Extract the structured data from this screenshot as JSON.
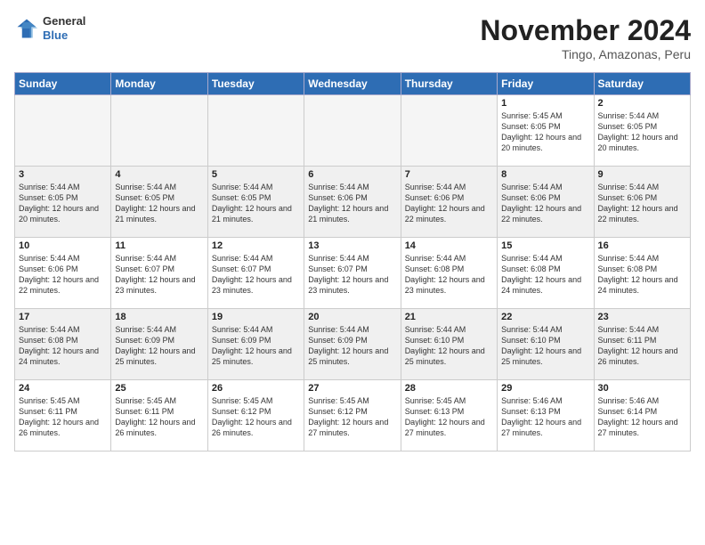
{
  "logo": {
    "general": "General",
    "blue": "Blue"
  },
  "header": {
    "month": "November 2024",
    "location": "Tingo, Amazonas, Peru"
  },
  "weekdays": [
    "Sunday",
    "Monday",
    "Tuesday",
    "Wednesday",
    "Thursday",
    "Friday",
    "Saturday"
  ],
  "weeks": [
    [
      {
        "day": "",
        "info": "",
        "empty": true
      },
      {
        "day": "",
        "info": "",
        "empty": true
      },
      {
        "day": "",
        "info": "",
        "empty": true
      },
      {
        "day": "",
        "info": "",
        "empty": true
      },
      {
        "day": "",
        "info": "",
        "empty": true
      },
      {
        "day": "1",
        "info": "Sunrise: 5:45 AM\nSunset: 6:05 PM\nDaylight: 12 hours and 20 minutes."
      },
      {
        "day": "2",
        "info": "Sunrise: 5:44 AM\nSunset: 6:05 PM\nDaylight: 12 hours and 20 minutes."
      }
    ],
    [
      {
        "day": "3",
        "info": "Sunrise: 5:44 AM\nSunset: 6:05 PM\nDaylight: 12 hours and 20 minutes."
      },
      {
        "day": "4",
        "info": "Sunrise: 5:44 AM\nSunset: 6:05 PM\nDaylight: 12 hours and 21 minutes."
      },
      {
        "day": "5",
        "info": "Sunrise: 5:44 AM\nSunset: 6:05 PM\nDaylight: 12 hours and 21 minutes."
      },
      {
        "day": "6",
        "info": "Sunrise: 5:44 AM\nSunset: 6:06 PM\nDaylight: 12 hours and 21 minutes."
      },
      {
        "day": "7",
        "info": "Sunrise: 5:44 AM\nSunset: 6:06 PM\nDaylight: 12 hours and 22 minutes."
      },
      {
        "day": "8",
        "info": "Sunrise: 5:44 AM\nSunset: 6:06 PM\nDaylight: 12 hours and 22 minutes."
      },
      {
        "day": "9",
        "info": "Sunrise: 5:44 AM\nSunset: 6:06 PM\nDaylight: 12 hours and 22 minutes."
      }
    ],
    [
      {
        "day": "10",
        "info": "Sunrise: 5:44 AM\nSunset: 6:06 PM\nDaylight: 12 hours and 22 minutes."
      },
      {
        "day": "11",
        "info": "Sunrise: 5:44 AM\nSunset: 6:07 PM\nDaylight: 12 hours and 23 minutes."
      },
      {
        "day": "12",
        "info": "Sunrise: 5:44 AM\nSunset: 6:07 PM\nDaylight: 12 hours and 23 minutes."
      },
      {
        "day": "13",
        "info": "Sunrise: 5:44 AM\nSunset: 6:07 PM\nDaylight: 12 hours and 23 minutes."
      },
      {
        "day": "14",
        "info": "Sunrise: 5:44 AM\nSunset: 6:08 PM\nDaylight: 12 hours and 23 minutes."
      },
      {
        "day": "15",
        "info": "Sunrise: 5:44 AM\nSunset: 6:08 PM\nDaylight: 12 hours and 24 minutes."
      },
      {
        "day": "16",
        "info": "Sunrise: 5:44 AM\nSunset: 6:08 PM\nDaylight: 12 hours and 24 minutes."
      }
    ],
    [
      {
        "day": "17",
        "info": "Sunrise: 5:44 AM\nSunset: 6:08 PM\nDaylight: 12 hours and 24 minutes."
      },
      {
        "day": "18",
        "info": "Sunrise: 5:44 AM\nSunset: 6:09 PM\nDaylight: 12 hours and 25 minutes."
      },
      {
        "day": "19",
        "info": "Sunrise: 5:44 AM\nSunset: 6:09 PM\nDaylight: 12 hours and 25 minutes."
      },
      {
        "day": "20",
        "info": "Sunrise: 5:44 AM\nSunset: 6:09 PM\nDaylight: 12 hours and 25 minutes."
      },
      {
        "day": "21",
        "info": "Sunrise: 5:44 AM\nSunset: 6:10 PM\nDaylight: 12 hours and 25 minutes."
      },
      {
        "day": "22",
        "info": "Sunrise: 5:44 AM\nSunset: 6:10 PM\nDaylight: 12 hours and 25 minutes."
      },
      {
        "day": "23",
        "info": "Sunrise: 5:44 AM\nSunset: 6:11 PM\nDaylight: 12 hours and 26 minutes."
      }
    ],
    [
      {
        "day": "24",
        "info": "Sunrise: 5:45 AM\nSunset: 6:11 PM\nDaylight: 12 hours and 26 minutes."
      },
      {
        "day": "25",
        "info": "Sunrise: 5:45 AM\nSunset: 6:11 PM\nDaylight: 12 hours and 26 minutes."
      },
      {
        "day": "26",
        "info": "Sunrise: 5:45 AM\nSunset: 6:12 PM\nDaylight: 12 hours and 26 minutes."
      },
      {
        "day": "27",
        "info": "Sunrise: 5:45 AM\nSunset: 6:12 PM\nDaylight: 12 hours and 27 minutes."
      },
      {
        "day": "28",
        "info": "Sunrise: 5:45 AM\nSunset: 6:13 PM\nDaylight: 12 hours and 27 minutes."
      },
      {
        "day": "29",
        "info": "Sunrise: 5:46 AM\nSunset: 6:13 PM\nDaylight: 12 hours and 27 minutes."
      },
      {
        "day": "30",
        "info": "Sunrise: 5:46 AM\nSunset: 6:14 PM\nDaylight: 12 hours and 27 minutes."
      }
    ]
  ]
}
